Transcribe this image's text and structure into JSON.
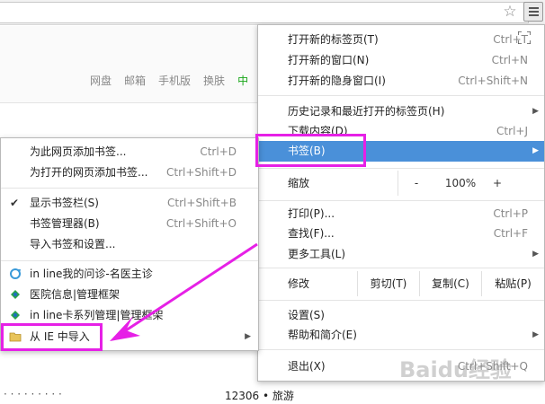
{
  "page": {
    "nav": [
      "网盘",
      "邮箱",
      "手机版",
      "换肤",
      "中"
    ],
    "bottom_left": "· · ·  ·  · · · · ·",
    "bottom_mid": "12306 • 旅游"
  },
  "main_menu": {
    "new_tab": {
      "label": "打开新的标签页(T)",
      "shortcut": "Ctrl+T"
    },
    "new_window": {
      "label": "打开新的窗口(N)",
      "shortcut": "Ctrl+N"
    },
    "incognito": {
      "label": "打开新的隐身窗口(I)",
      "shortcut": "Ctrl+Shift+N"
    },
    "history": {
      "label": "历史记录和最近打开的标签页(H)"
    },
    "downloads": {
      "label": "下载内容(D)",
      "shortcut": "Ctrl+J"
    },
    "bookmarks": {
      "label": "书签(B)"
    },
    "zoom": {
      "label": "缩放",
      "minus": "-",
      "value": "100%",
      "plus": "+"
    },
    "print": {
      "label": "打印(P)...",
      "shortcut": "Ctrl+P"
    },
    "find": {
      "label": "查找(F)...",
      "shortcut": "Ctrl+F"
    },
    "more_tools": {
      "label": "更多工具(L)"
    },
    "edit": {
      "label": "修改",
      "cut": "剪切(T)",
      "copy": "复制(C)",
      "paste": "粘贴(P)"
    },
    "settings": {
      "label": "设置(S)"
    },
    "help": {
      "label": "帮助和简介(E)"
    },
    "exit": {
      "label": "退出(X)",
      "shortcut": "Ctrl+Shift+Q"
    }
  },
  "bookmarks_menu": {
    "add_page": {
      "label": "为此网页添加书签...",
      "shortcut": "Ctrl+D"
    },
    "add_all": {
      "label": "为打开的网页添加书签...",
      "shortcut": "Ctrl+Shift+D"
    },
    "show_bar": {
      "label": "显示书签栏(S)",
      "shortcut": "Ctrl+Shift+B"
    },
    "manager": {
      "label": "书签管理器(B)",
      "shortcut": "Ctrl+Shift+O"
    },
    "import": {
      "label": "导入书签和设置..."
    },
    "items": [
      {
        "label": "in line我的问诊-名医主诊"
      },
      {
        "label": "医院信息|管理框架"
      },
      {
        "label": "in line卡系列管理|管理框架"
      }
    ],
    "from_ie": {
      "label": "从 IE 中导入"
    }
  },
  "watermark": "Baidu经验",
  "colors": {
    "highlight": "#4a90d9",
    "annotation": "#e620e6"
  },
  "icons": {
    "star": "☆",
    "check": "✔",
    "arrow": "▶"
  }
}
